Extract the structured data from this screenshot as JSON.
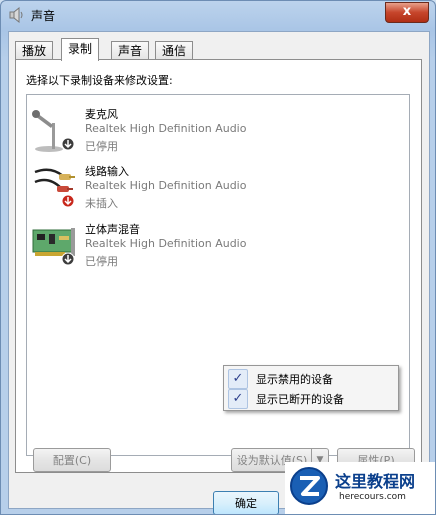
{
  "window": {
    "title": "声音",
    "close_glyph": "x"
  },
  "tabs": [
    {
      "label": "播放",
      "active": false
    },
    {
      "label": "录制",
      "active": true
    },
    {
      "label": "声音",
      "active": false
    },
    {
      "label": "通信",
      "active": false
    }
  ],
  "instruction": "选择以下录制设备来修改设置:",
  "devices": [
    {
      "name": "麦克风",
      "driver": "Realtek High Definition Audio",
      "status": "已停用",
      "icon": "microphone-icon",
      "badge": "disabled-down-arrow-icon"
    },
    {
      "name": "线路输入",
      "driver": "Realtek High Definition Audio",
      "status": "未插入",
      "icon": "line-in-cable-icon",
      "badge": "unplugged-red-arrow-icon"
    },
    {
      "name": "立体声混音",
      "driver": "Realtek High Definition Audio",
      "status": "已停用",
      "icon": "sound-card-icon",
      "badge": "disabled-down-arrow-icon"
    }
  ],
  "context_menu": [
    {
      "label": "显示禁用的设备",
      "checked": true,
      "check_glyph": "✓"
    },
    {
      "label": "显示已断开的设备",
      "checked": true,
      "check_glyph": "✓"
    }
  ],
  "buttons": {
    "configure": "配置(C)",
    "set_default": "设为默认值(S)",
    "set_default_arrow": "▼",
    "properties": "属性(P)",
    "ok": "确定"
  },
  "watermark": {
    "title": "这里教程网",
    "url": "herecours.com"
  },
  "colors": {
    "title_bar": "#b7cfea",
    "close_button": "#c6452b",
    "check": "#2c3f8c",
    "watermark_blue": "#0a3f8c"
  }
}
